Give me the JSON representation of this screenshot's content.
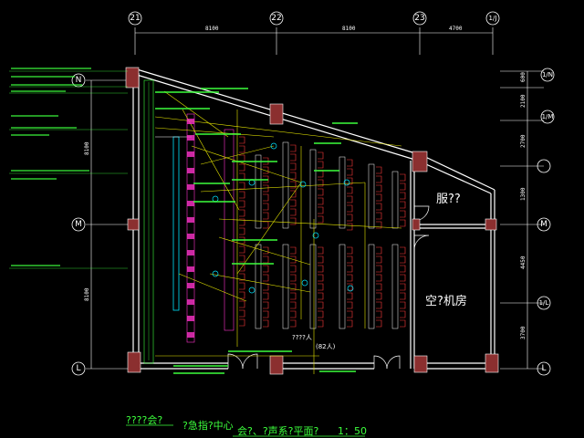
{
  "axes_top": [
    "21",
    "22",
    "23",
    "1/J"
  ],
  "axes_left": [
    "N",
    "M",
    "L"
  ],
  "axes_right": [
    "1/N",
    "1/M",
    "1/L"
  ],
  "dims_top": [
    "8100",
    "8100",
    "4700"
  ],
  "dims_left": [
    "8100",
    "8100"
  ],
  "dims_right": [
    "600",
    "2100",
    "2700",
    "1300",
    "4450",
    "3700"
  ],
  "rooms": {
    "service": "服??",
    "ac_room": "空?机房"
  },
  "notes": {
    "seats": "????人",
    "seats_sub": "(82人)"
  },
  "titles": {
    "left": "????会?",
    "center": "?急指?中心",
    "main": "会?、?声系?平面?",
    "scale": "1：50"
  },
  "colors": {
    "background": "#000000",
    "wall": "#ffffff",
    "column": "#8b2f2f",
    "annotation": "#3cff3c",
    "cable": "#e6e600",
    "cyan": "#00e5ff",
    "magenta": "#ff33cc",
    "chair": "#ff3b3b"
  }
}
